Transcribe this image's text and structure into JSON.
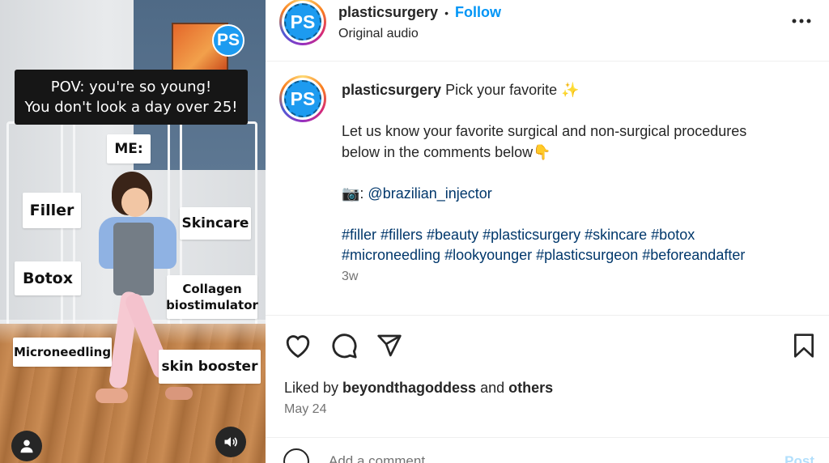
{
  "video": {
    "watermark": "PS",
    "pov_line1": "POV: you're so young!",
    "pov_line2": "You don't look a day over 25!",
    "labels": {
      "me": "ME:",
      "filler": "Filler",
      "skincare": "Skincare",
      "botox": "Botox",
      "collagen_line1": "Collagen",
      "collagen_line2": "biostimulator",
      "microneedling": "Microneedling",
      "skin_booster": "skin booster"
    },
    "icons": {
      "user": "user-icon",
      "audio": "speaker-icon"
    }
  },
  "header": {
    "avatar_text": "PS",
    "username": "plasticsurgery",
    "separator": "•",
    "follow_label": "Follow",
    "subtitle": "Original audio",
    "more_icon": "more-options-icon"
  },
  "caption": {
    "avatar_text": "PS",
    "username": "plasticsurgery",
    "headline": "Pick your favorite ✨",
    "line1": "Let us know your favorite surgical and non-surgical procedures",
    "line2": "below in the comments below👇",
    "credit_prefix": "📷: ",
    "credit_handle": "@brazilian_injector",
    "hashtags_line1": "#filler #fillers #beauty #plasticsurgery #skincare #botox",
    "hashtags_line2": "#microneedling #lookyounger #plasticsurgeon #beforeandafter",
    "time": "3w"
  },
  "actions": {
    "like_icon": "heart-icon",
    "comment_icon": "comment-icon",
    "share_icon": "send-icon",
    "save_icon": "bookmark-icon",
    "liked_prefix": "Liked by ",
    "liked_user": "beyondthagoddess",
    "liked_and": " and ",
    "liked_others": "others",
    "date": "May 24"
  },
  "comment": {
    "emoji_icon": "emoji-icon",
    "placeholder": "Add a comment…",
    "post_label": "Post"
  },
  "colors": {
    "accent": "#0095f6",
    "brand_blue": "#1d9bf0",
    "link": "#00376b",
    "muted": "#737373"
  }
}
